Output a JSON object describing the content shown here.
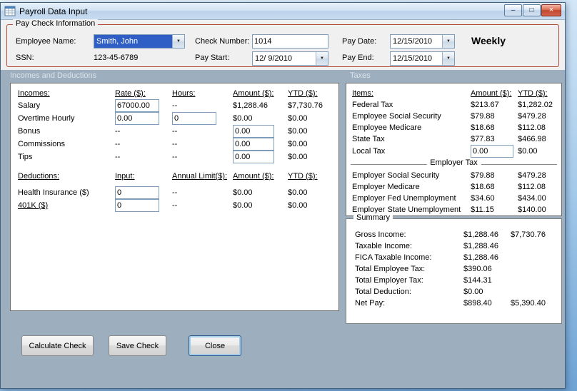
{
  "window": {
    "title": "Payroll Data Input"
  },
  "icons": {
    "dropdown": "▼",
    "minimize": "–",
    "maximize": "□",
    "close": "×"
  },
  "paycheck_info": {
    "legend": "Pay Check Information",
    "employee_name_label": "Employee Name:",
    "employee_name_value": "Smith, John",
    "ssn_label": "SSN:",
    "ssn_value": "123-45-6789",
    "check_number_label": "Check Number:",
    "check_number_value": "1014",
    "pay_start_label": "Pay Start:",
    "pay_start_value": "12/ 9/2010",
    "pay_date_label": "Pay Date:",
    "pay_date_value": "12/15/2010",
    "pay_end_label": "Pay End:",
    "pay_end_value": "12/15/2010",
    "frequency": "Weekly"
  },
  "sections": {
    "incomes_deductions": "Incomes and Deductions",
    "taxes": "Taxes"
  },
  "incomes": {
    "headers": {
      "name": "Incomes:",
      "rate": "Rate ($):",
      "hours": "Hours:",
      "amount": "Amount ($):",
      "ytd": "YTD ($):"
    },
    "rows": [
      {
        "name": "Salary",
        "rate": "67000.00",
        "hours": "--",
        "amount": "$1,288.46",
        "ytd": "$7,730.76"
      },
      {
        "name": "Overtime Hourly",
        "rate": "0.00",
        "hours": "0",
        "amount": "$0.00",
        "ytd": "$0.00"
      },
      {
        "name": "Bonus",
        "rate": "--",
        "hours": "--",
        "amount": "0.00",
        "ytd": "$0.00"
      },
      {
        "name": "Commissions",
        "rate": "--",
        "hours": "--",
        "amount": "0.00",
        "ytd": "$0.00"
      },
      {
        "name": "Tips",
        "rate": "--",
        "hours": "--",
        "amount": "0.00",
        "ytd": "$0.00"
      }
    ]
  },
  "deductions": {
    "headers": {
      "name": "Deductions:",
      "input": "Input:",
      "limit": "Annual Limit($):",
      "amount": "Amount ($):",
      "ytd": "YTD ($):"
    },
    "rows": [
      {
        "name": "Health Insurance  ($)",
        "input": "0",
        "limit": "--",
        "amount": "$0.00",
        "ytd": "$0.00"
      },
      {
        "name": "401K  ($)",
        "input": "0",
        "limit": "--",
        "amount": "$0.00",
        "ytd": "$0.00"
      }
    ]
  },
  "taxes": {
    "headers": {
      "name": "Items:",
      "amount": "Amount ($):",
      "ytd": "YTD ($):"
    },
    "employee_rows": [
      {
        "name": "Federal Tax",
        "amount": "$213.67",
        "ytd": "$1,282.02"
      },
      {
        "name": "Employee Social Security",
        "amount": "$79.88",
        "ytd": "$479.28"
      },
      {
        "name": "Employee Medicare",
        "amount": "$18.68",
        "ytd": "$112.08"
      },
      {
        "name": "State Tax",
        "amount": "$77.83",
        "ytd": "$466.98"
      },
      {
        "name": "Local Tax",
        "amount": "0.00",
        "ytd": "$0.00"
      }
    ],
    "employer_group_label": "Employer Tax",
    "employer_rows": [
      {
        "name": "Employer Social Security",
        "amount": "$79.88",
        "ytd": "$479.28"
      },
      {
        "name": "Employer Medicare",
        "amount": "$18.68",
        "ytd": "$112.08"
      },
      {
        "name": "Employer Fed Unemployment",
        "amount": "$34.60",
        "ytd": "$434.00"
      },
      {
        "name": "Employer State Unemployment",
        "amount": "$11.15",
        "ytd": "$140.00"
      }
    ]
  },
  "summary": {
    "legend": "Summary",
    "rows": [
      {
        "name": "Gross Income:",
        "amount": "$1,288.46",
        "ytd": "$7,730.76"
      },
      {
        "name": "Taxable Income:",
        "amount": "$1,288.46",
        "ytd": ""
      },
      {
        "name": "FICA Taxable Income:",
        "amount": "$1,288.46",
        "ytd": ""
      },
      {
        "name": "Total Employee Tax:",
        "amount": "$390.06",
        "ytd": ""
      },
      {
        "name": "Total Employer Tax:",
        "amount": "$144.31",
        "ytd": ""
      },
      {
        "name": "Total Deduction:",
        "amount": "$0.00",
        "ytd": ""
      },
      {
        "name": "Net Pay:",
        "amount": "$898.40",
        "ytd": "$5,390.40"
      }
    ]
  },
  "buttons": {
    "calculate": "Calculate Check",
    "save": "Save Check",
    "close": "Close"
  },
  "colors": {
    "groupbox_border": "#b04a3a",
    "selection_bg": "#2f5fc4",
    "workspace_bg": "#9dafbf",
    "close_red": "#c04830"
  }
}
